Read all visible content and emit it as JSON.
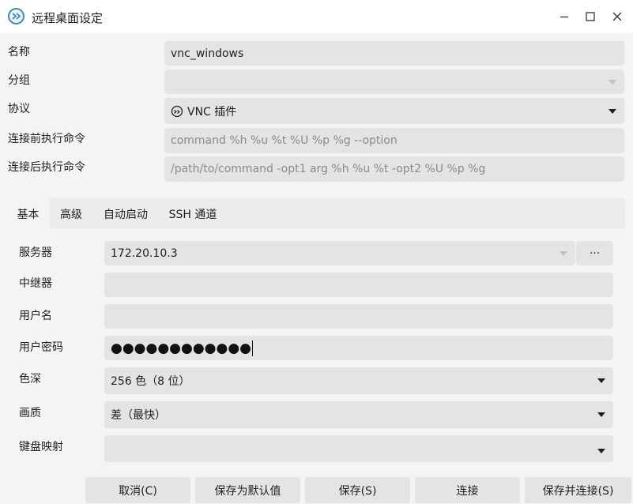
{
  "window": {
    "title": "远程桌面设定",
    "icon": "remmina-icon",
    "controls": [
      "minimize-icon",
      "maximize-icon",
      "close-icon"
    ]
  },
  "form": {
    "name_label": "名称",
    "name_value": "vnc_windows",
    "group_label": "分组",
    "group_value": "",
    "protocol_label": "协议",
    "protocol_value": "VNC 插件",
    "pre_cmd_label": "连接前执行命令",
    "pre_cmd_placeholder": "command %h %u %t %U %p %g --option",
    "post_cmd_label": "连接后执行命令",
    "post_cmd_placeholder": "/path/to/command -opt1 arg %h %u %t -opt2 %U %p %g"
  },
  "tabs": [
    {
      "label": "基本",
      "active": true
    },
    {
      "label": "高级",
      "active": false
    },
    {
      "label": "自动启动",
      "active": false
    },
    {
      "label": "SSH 通道",
      "active": false
    }
  ],
  "basic": {
    "server_label": "服务器",
    "server_value": "172.20.10.3",
    "server_browse": "···",
    "repeater_label": "中继器",
    "repeater_value": "",
    "username_label": "用户名",
    "username_value": "",
    "password_label": "用户密码",
    "password_value": "●●●●●●●●●●●●",
    "color_depth_label": "色深",
    "color_depth_value": "256 色（8 位）",
    "quality_label": "画质",
    "quality_value": "差（最快）",
    "keymap_label": "键盘映射",
    "keymap_value": ""
  },
  "buttons": {
    "cancel": "取消(C)",
    "save_default": "保存为默认值",
    "save": "保存(S)",
    "connect": "连接",
    "save_connect": "保存并连接(S)"
  }
}
